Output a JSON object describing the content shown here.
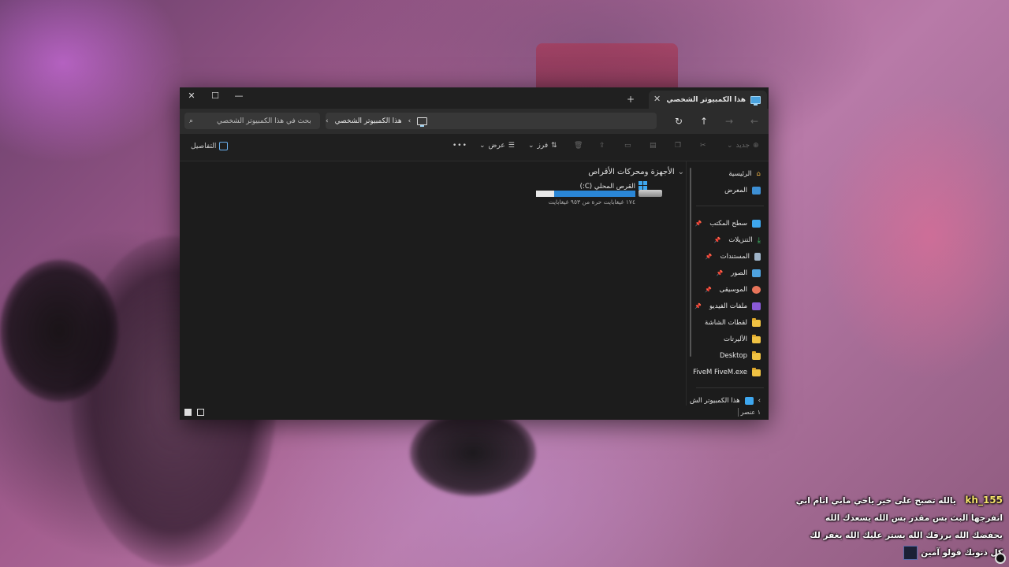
{
  "window": {
    "tab_title": "هذا الكمبيوتر الشخصي",
    "new_tab": "+",
    "tab_close": "✕",
    "minimize": "—",
    "maximize": "☐",
    "close": "✕"
  },
  "address": {
    "crumb_root": "›",
    "crumb_current": "هذا الكمبيوتر الشخصي",
    "crumb_end": "›",
    "search_placeholder": "بحث في هذا الكمبيوتر الشخصي"
  },
  "toolbar": {
    "new_label": "جديد",
    "sort_label": "فرز",
    "view_label": "عرض",
    "more_label": "•••",
    "details_label": "التفاصيل"
  },
  "content": {
    "section_title": "الأجهزة ومحركات الأقراص",
    "drive": {
      "name": "القرص المحلي (C:)",
      "free_text": "١٧٤ غيغابايت حرة من ٩٥٣ غيغابايت",
      "used_fraction": 0.82
    }
  },
  "sidebar": {
    "home": "الرئيسية",
    "gallery": "المعرض",
    "desktop": "سطح المكتب",
    "downloads": "التنزيلات",
    "documents": "المستندات",
    "pictures": "الصور",
    "music": "الموسيقى",
    "videos": "ملفات الفيديو",
    "screenshots": "لقطات الشاشة",
    "ps": "الأليرتات",
    "desktop_en": "Desktop",
    "fivem": "FiveM FiveM.exe",
    "this_pc": "هذا الكمبيوتر الش"
  },
  "status": {
    "count": "١ عنصر"
  },
  "chat": {
    "user": "kh_155",
    "lines": [
      "يالله تصبح على خير ياخي مابي انام ابي",
      "اتفرجها البث بس مقدر بس الله يسعدك الله",
      "يحفضك الله يرزقك الله يستر عليك الله يغفر لك",
      "كل ذنوبك قولو آمين"
    ]
  }
}
